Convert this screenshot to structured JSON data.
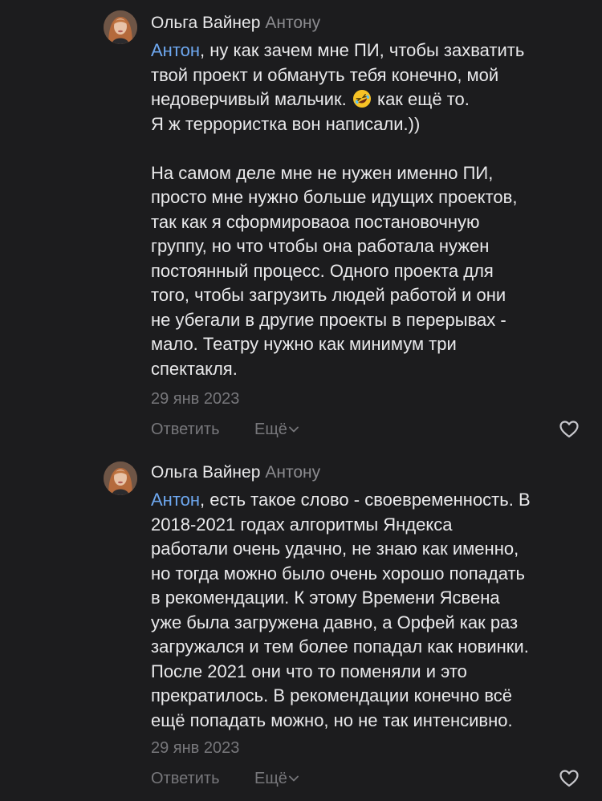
{
  "comments": [
    {
      "author": "Ольга Вайнер",
      "reply_to": "Антону",
      "mention": "Антон",
      "text_part1": ", ну как зачем мне ПИ, чтобы захватить\nтвой проект и обмануть тебя конечно, мой\nнедоверчивый мальчик. ",
      "emoji": "rolling-on-floor-laughing-emoji",
      "text_part2": " как ещё то.\nЯ ж террористка вон написали.))\n\nНа самом деле мне не нужен именно ПИ,\nпросто мне нужно больше идущих проектов,\nтак как я сформироваоа постановочную\nгруппу, но что чтобы она работала нужен\nпостоянный процесс. Одного проекта для\nтого, чтобы загрузить людей работой и они\nне убегали в другие проекты в перерывах -\nмало. Театру нужно как минимум три\nспектакля.",
      "date": "29 янв 2023",
      "reply_label": "Ответить",
      "more_label": "Ещё"
    },
    {
      "author": "Ольга Вайнер",
      "reply_to": "Антону",
      "mention": "Антон",
      "text": ", есть такое слово - своевременность. В\n2018-2021 годах алгоритмы Яндекса\nработали очень удачно, не знаю как именно,\nно тогда можно было очень хорошо попадать\nв рекомендации. К этому Времени Ясвена\nуже была загружена давно, а Орфей как раз\nзагружался и тем более попадал как новинки.\nПосле 2021 они что то поменяли и это\nпрекратилось. В рекомендации конечно всё\nещё попадать можно, но не так интенсивно.",
      "date": "29 янв 2023",
      "reply_label": "Ответить",
      "more_label": "Ещё"
    }
  ],
  "colors": {
    "background": "#1c1c1e",
    "text": "#e9e9eb",
    "secondary": "#77777b",
    "mention": "#6ea8f0"
  },
  "icons": {
    "avatar": "avatar",
    "like": "heart-icon",
    "more": "chevron-down-icon"
  }
}
